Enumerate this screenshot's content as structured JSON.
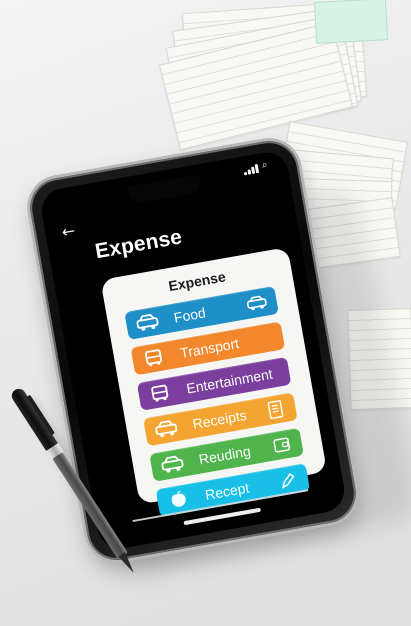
{
  "scene": {
    "title": "Expense",
    "card_title": "Expense"
  },
  "categories": [
    {
      "label": "Food",
      "icon": "car-icon",
      "right_icon": "car-icon",
      "color": "#1e8fc7"
    },
    {
      "label": "Transport",
      "icon": "bus-icon",
      "right_icon": "",
      "color": "#f2872b"
    },
    {
      "label": "Entertainment",
      "icon": "bus-icon",
      "right_icon": "",
      "color": "#7a3f9d"
    },
    {
      "label": "Receipts",
      "icon": "car-icon",
      "right_icon": "receipt-icon",
      "color": "#f4a531"
    },
    {
      "label": "Reuding",
      "icon": "car-icon",
      "right_icon": "wallet-icon",
      "color": "#4fb44c"
    },
    {
      "label": "Recept",
      "icon": "apple-icon",
      "right_icon": "pen-icon",
      "color": "#18bfe7"
    }
  ],
  "colors": {
    "phone_bezel": "#111111",
    "screen_bg": "#000000",
    "card_bg": "#f6f6f4",
    "paper_bg": "#f8f8f4",
    "mint_receipt": "#d7f2e6"
  }
}
